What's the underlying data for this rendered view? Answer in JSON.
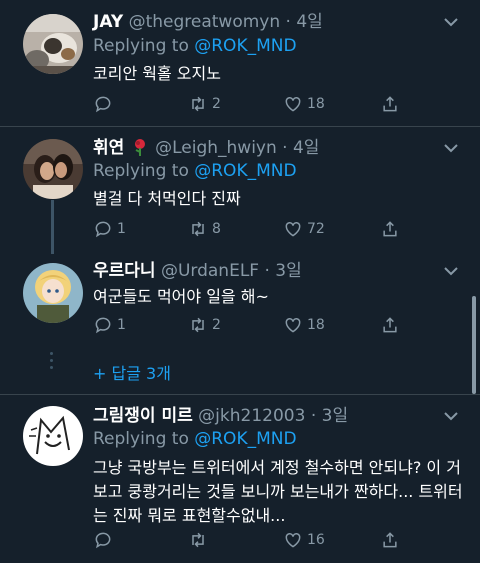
{
  "tweets": [
    {
      "name": "JAY",
      "handle": "@thegreatwomyn",
      "dot": "·",
      "time": "4일",
      "replying_to_label": "Replying to",
      "replying_to": "@ROK_MND",
      "text": "코리안 웍홀 오지노",
      "reply_count": "",
      "retweet_count": "2",
      "like_count": "18"
    },
    {
      "name": "휘연",
      "handle": "@Leigh_hwiyn",
      "dot": "·",
      "time": "4일",
      "replying_to_label": "Replying to",
      "replying_to": "@ROK_MND",
      "text": "별걸 다 처먹인다 진짜",
      "reply_count": "1",
      "retweet_count": "8",
      "like_count": "72"
    },
    {
      "name": "우르다니",
      "handle": "@UrdanELF",
      "dot": "·",
      "time": "3일",
      "text": "여군들도 먹어야 일을 해~",
      "reply_count": "1",
      "retweet_count": "2",
      "like_count": "18"
    },
    {
      "name": "그림쟁이 미르",
      "handle": "@jkh212003",
      "dot": "·",
      "time": "3일",
      "replying_to_label": "Replying to",
      "replying_to": "@ROK_MND",
      "text": "그냥 국방부는 트위터에서 계정 철수하면 안되냐? 이 거보고 쿵쾅거리는 것들 보니까 보는내가 짠하다... 트위터는 진짜 뭐로 표현할수없내...",
      "reply_count": "",
      "retweet_count": "",
      "like_count": "16"
    }
  ],
  "show_more": "+ 답글 3개",
  "colors": {
    "background": "#15202b",
    "accent": "#1da1f2",
    "muted": "#8899a6",
    "divider": "#38444d"
  },
  "icons": [
    "reply-icon",
    "retweet-icon",
    "like-icon",
    "share-icon",
    "chevron-down-icon",
    "rose-emoji-icon"
  ]
}
